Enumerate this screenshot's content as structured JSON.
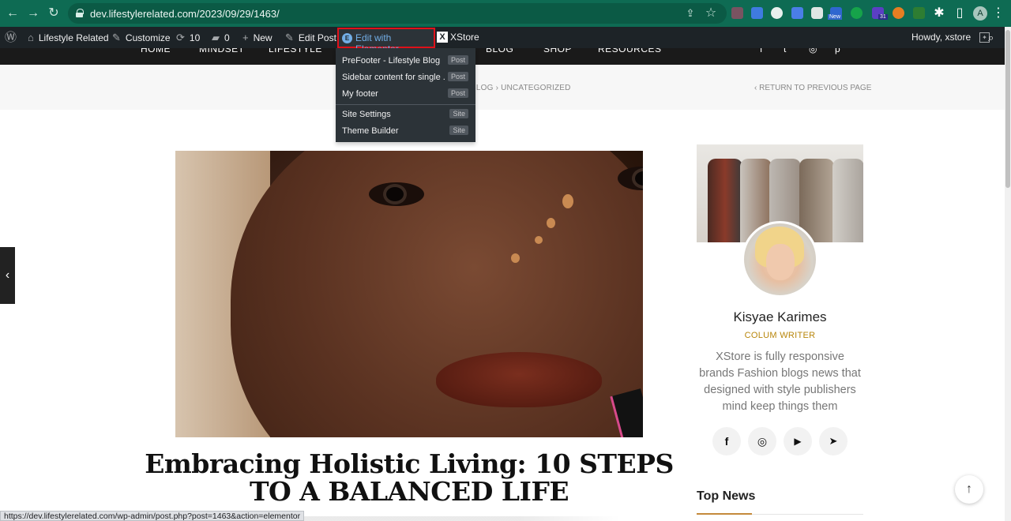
{
  "browser": {
    "url": "dev.lifestylerelated.com/2023/09/29/1463/",
    "profile_initial": "A",
    "icons": [
      "back-icon",
      "forward-icon",
      "reload-icon",
      "lock-icon",
      "share-icon",
      "star-icon",
      "extensions-icon",
      "side-panel-icon",
      "profile-icon"
    ],
    "badges": {
      "new": "New",
      "calendar": "31"
    }
  },
  "admin_bar": {
    "site_name": "Lifestyle Related",
    "customize": "Customize",
    "updates_count": "10",
    "comments_count": "0",
    "new": "New",
    "edit_post": "Edit Post",
    "edit_with_elementor": "Edit with Elementor",
    "xstore": "XStore",
    "howdy": "Howdy, xstore",
    "highlight_color": "#e1121b"
  },
  "elementor_menu": {
    "items": [
      {
        "label": "PreFooter - Lifestyle Blog",
        "badge": "Post"
      },
      {
        "label": "Sidebar content for single ...",
        "badge": "Post"
      },
      {
        "label": "My footer",
        "badge": "Post"
      },
      {
        "label": "Site Settings",
        "badge": "Site"
      },
      {
        "label": "Theme Builder",
        "badge": "Site"
      }
    ]
  },
  "site_nav": [
    "HOME",
    "MINDSET",
    "LIFESTYLE",
    "BLOG",
    "SHOP",
    "RESOURCES"
  ],
  "breadcrumb": {
    "path": "BLOG › UNCATEGORIZED",
    "return": "‹ RETURN TO PREVIOUS PAGE"
  },
  "post": {
    "title": "Embracing Holistic Living: 10 STEPS TO A BALANCED LIFE"
  },
  "author_card": {
    "name": "Kisyae Karimes",
    "role": "COLUM WRITER",
    "bio": "XStore is fully responsive brands Fashion blogs news that designed with style publishers mind keep things them",
    "socials": [
      "facebook-icon",
      "instagram-icon",
      "youtube-icon",
      "telegram-icon"
    ]
  },
  "sidebar": {
    "top_news": "Top News",
    "accent": "#c48a3b"
  },
  "status_bar": {
    "link": "https://dev.lifestylerelated.com/wp-admin/post.php?post=1463&action=elementor"
  }
}
